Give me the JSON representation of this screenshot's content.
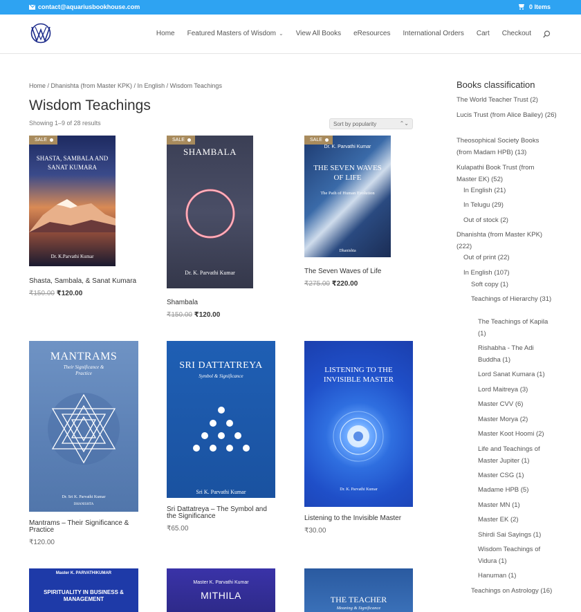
{
  "topbar": {
    "email": "contact@aquariusbookhouse.com",
    "cart": "0 Items"
  },
  "nav": {
    "items": [
      "Home",
      "Featured Masters of Wisdom",
      "View All Books",
      "eResources",
      "International Orders",
      "Cart",
      "Checkout"
    ]
  },
  "breadcrumb": "Home / Dhanishta (from Master KPK) / In English / Wisdom Teachings",
  "page_title": "Wisdom Teachings",
  "results": "Showing 1–9 of 28 results",
  "sort": "Sort by popularity",
  "sale_label": "SALE",
  "products": [
    {
      "title": "Shasta, Sambala, & Sanat Kumara",
      "old": "₹150.00",
      "price": "₹120.00",
      "cover_title": "SHASTA, SAMBALA AND SANAT KUMARA",
      "cover_author": "Dr. K.Parvathi Kumar"
    },
    {
      "title": "Shambala",
      "old": "₹150.00",
      "price": "₹120.00",
      "cover_title": "SHAMBALA",
      "cover_author": "Dr. K. Parvathi Kumar"
    },
    {
      "title": "The Seven Waves of Life",
      "old": "₹275.00",
      "price": "₹220.00",
      "cover_title": "THE SEVEN WAVES OF LIFE",
      "cover_sub": "The Path of Human Evolution",
      "cover_author": "Dr. K. Parvathi Kumar",
      "cover_pub": "Dhanishta"
    },
    {
      "title": "Mantrams – Their Significance & Practice",
      "price": "₹120.00",
      "cover_title": "MANTRAMS",
      "cover_sub": "Their Significance & Practice",
      "cover_author": "Dr. Sri K. Parvathi Kumar",
      "cover_pub": "DHANISHTA"
    },
    {
      "title": "Sri Dattatreya – The Symbol and the Significance",
      "price": "₹65.00",
      "cover_title": "SRI DATTATREYA",
      "cover_sub": "Symbol & Significance",
      "cover_author": "Sri K. Parvathi Kumar"
    },
    {
      "title": "Listening to the Invisible Master",
      "price": "₹30.00",
      "cover_title": "LISTENING TO THE INVISIBLE MASTER",
      "cover_author": "Dr. K. Parvathi Kumar"
    },
    {
      "cover_top": "Master K. PARVATHIKUMAR",
      "cover_title": "SPIRITUALITY IN BUSINESS & MANAGEMENT"
    },
    {
      "cover_top": "Master K. Parvathi Kumar",
      "cover_title": "MITHILA"
    },
    {
      "cover_title": "THE TEACHER",
      "cover_sub": "Meaning & Significance"
    }
  ],
  "sidebar": {
    "title": "Books classification",
    "items": [
      "The World Teacher Trust (2)",
      "Lucis Trust (from Alice Bailey) (26)",
      "Theosophical Society Books (from Madam HPB) (13)",
      "Kulapathi Book Trust (from Master EK) (52)",
      "In English (21)",
      "In Telugu (29)",
      "Out of stock (2)",
      "Dhanishta (from Master KPK) (222)",
      "Out of print (22)",
      "In English (107)",
      "Soft copy (1)",
      "Teachings of Hierarchy (31)",
      "The Teachings of Kapila (1)",
      "Rishabha - The Adi Buddha (1)",
      "Lord Sanat Kumara (1)",
      "Lord Maitreya (3)",
      "Master CVV (6)",
      "Master Morya (2)",
      "Master Koot Hoomi (2)",
      "Life and Teachings of Master Jupiter (1)",
      "Master CSG (1)",
      "Madame HPB (5)",
      "Master MN (1)",
      "Master EK (2)",
      "Shirdi Sai Sayings (1)",
      "Wisdom Teachings of Vidura (1)",
      "Hanuman (1)",
      "Teachings on Astrology (16)"
    ]
  }
}
